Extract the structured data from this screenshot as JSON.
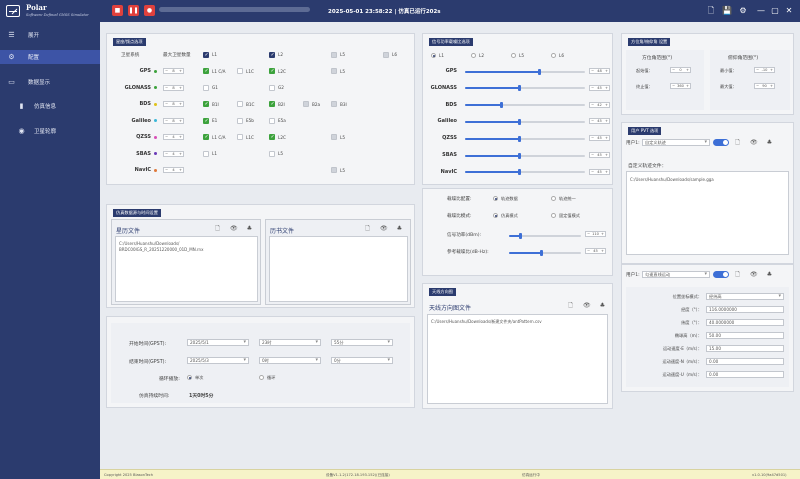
{
  "app": {
    "title": "Polar",
    "subtitle": "Software Defined GNSS Simulator"
  },
  "sidebar": {
    "expand": "展开",
    "items": [
      {
        "label": "配置"
      },
      {
        "label": "数据显示"
      },
      {
        "label": "仿真信息"
      },
      {
        "label": "卫星轮廓"
      }
    ]
  },
  "topbar": {
    "datetime": "2025-05-01 23:58:22",
    "sep": "|",
    "status": "仿真已运行202s"
  },
  "constellation": {
    "title": "星座/频点选项",
    "col_system": "卫星系统",
    "col_max": "最大卫星数量",
    "band_headers": [
      "L1",
      "L2",
      "L5",
      "L6"
    ],
    "rows": [
      {
        "name": "GPS",
        "color": "#3ca23c",
        "count": "8",
        "sigs": [
          "L1 C/A",
          "L1C",
          "L2C",
          "",
          "L5",
          ""
        ]
      },
      {
        "name": "GLONASS",
        "color": "#3ca23c",
        "count": "8",
        "sigs": [
          "G1",
          "",
          "G2",
          "",
          "",
          ""
        ]
      },
      {
        "name": "BDS",
        "color": "#e0c21a",
        "count": "8",
        "sigs": [
          "B1I",
          "B1C",
          "B2I",
          "B2a",
          "B3I",
          ""
        ]
      },
      {
        "name": "Galileo",
        "color": "#3ab7d8",
        "count": "8",
        "sigs": [
          "E1",
          "E5b",
          "E5a",
          "",
          "",
          ""
        ]
      },
      {
        "name": "QZSS",
        "color": "#d84fb7",
        "count": "4",
        "sigs": [
          "L1 C/A",
          "L1C",
          "L2C",
          "",
          "L5",
          ""
        ]
      },
      {
        "name": "SBAS",
        "color": "#6a3ab7",
        "count": "4",
        "sigs": [
          "L1",
          "",
          "L5",
          "",
          "",
          ""
        ]
      },
      {
        "name": "NavIC",
        "color": "#e0793a",
        "count": "4",
        "sigs": [
          "",
          "",
          "",
          "",
          "L5",
          ""
        ]
      }
    ]
  },
  "signal": {
    "title": "信号功率载噪比选项",
    "bands": [
      "L1",
      "L2",
      "L5",
      "L6"
    ],
    "rows": [
      {
        "name": "GPS",
        "value": "48",
        "level": 0.62
      },
      {
        "name": "GLONASS",
        "value": "45",
        "level": 0.45
      },
      {
        "name": "BDS",
        "value": "42",
        "level": 0.3
      },
      {
        "name": "Galileo",
        "value": "45",
        "level": 0.45
      },
      {
        "name": "QZSS",
        "value": "45",
        "level": 0.45
      },
      {
        "name": "SBAS",
        "value": "45",
        "level": 0.45
      },
      {
        "name": "NavIC",
        "value": "45",
        "level": 0.45
      }
    ],
    "cnr_config_label": "载噪比配置:",
    "cnr_config_options": [
      "轨迹数据",
      "轨迹统一"
    ],
    "cnr_mode_label": "载噪比模式:",
    "cnr_mode_options": [
      "仿真模式",
      "固定值模式"
    ],
    "power_label": "信号功率(dBm):",
    "power_value": "110",
    "power_level": 0.15,
    "ref_label": "参考载噪比(dB-Hz):",
    "ref_value": "45",
    "ref_level": 0.45
  },
  "angle": {
    "title": "方位角/俯仰角 设置",
    "az_title": "方位角范围(°)",
    "el_title": "俯仰角范围(°)",
    "az_start_label": "起始值：",
    "az_start": "0",
    "az_end_label": "终止值：",
    "az_end": "360",
    "el_min_label": "最小值：",
    "el_min": "-10",
    "el_max_label": "最大值：",
    "el_max": "90"
  },
  "user_pvt": {
    "title": "用户 PVT 选项",
    "user1_label": "用户1:",
    "user1_mode": "自定义轨迹",
    "traj_label": "自定义轨迹文件：",
    "traj_path": "C:/Users/Huanshu/Downloads/sample.gga",
    "user2_label": "用户1:",
    "user2_mode": "匀速直线运动",
    "fields": [
      {
        "label": "位置坐标模式：",
        "value": "经纬高",
        "select": true
      },
      {
        "label": "经度（°）：",
        "value": "116.0000000"
      },
      {
        "label": "纬度（°）：",
        "value": "40.0000000"
      },
      {
        "label": "椭球高（m）：",
        "value": "50.00"
      },
      {
        "label": "运动速度-E（m/s）：",
        "value": "15.00"
      },
      {
        "label": "运动速度-N（m/s）：",
        "value": "0.00"
      },
      {
        "label": "运动速度-U（m/s）：",
        "value": "0.00"
      }
    ]
  },
  "sim": {
    "title": "仿真数据源与时间设置",
    "eph_title": "星历文件",
    "eph_path": "C:/Users/Huanshu/Downloads/\nBRDC00IGS_R_20251220000_01D_MN.rnx",
    "alm_title": "历书文件",
    "start_label": "开始时间(GPST):",
    "start_date": "2025/5/1",
    "start_hour": "23时",
    "start_min": "55分",
    "end_label": "结束时间(GPST):",
    "end_date": "2025/5/3",
    "end_hour": "0时",
    "end_min": "0分",
    "loop_label": "循环播放:",
    "loop_options": [
      "单次",
      "循环"
    ],
    "duration_label": "仿真持续时间:",
    "duration_value": "1天0时5分"
  },
  "antenna": {
    "title": "天线方向图",
    "file_title": "天线方向图文件",
    "path": "C:/Users/Huanshu/Downloads/新建文件夹/antPattern.csv"
  },
  "status": {
    "copyright": "Copyright 2025 BlasonTech",
    "device": "设备V1.1.2(172.18.193.152)(已连接)",
    "state": "仿真运行中",
    "version": "v1.0.10(9a47d501)"
  },
  "colors": {
    "primary": "#2b3b6e",
    "accent": "#3d6fd6",
    "danger": "#e0413d"
  }
}
